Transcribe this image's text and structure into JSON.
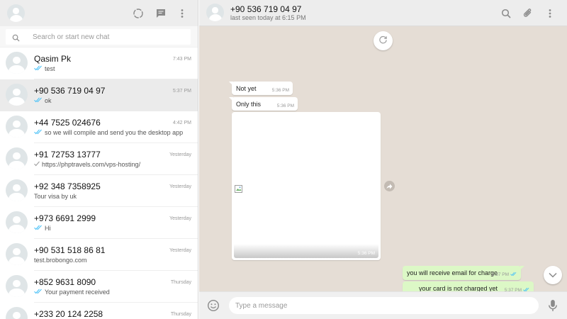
{
  "sidebar": {
    "search_placeholder": "Search or start new chat",
    "header_icons": [
      "status-icon",
      "new-chat-icon",
      "menu-icon"
    ],
    "chats": [
      {
        "name": "Qasim Pk",
        "time": "7:43 PM",
        "preview": "test",
        "tick": "double-blue"
      },
      {
        "name": "+90 536 719 04 97",
        "time": "5:37 PM",
        "preview": "ok",
        "tick": "double-blue",
        "active": true
      },
      {
        "name": "+44 7525 024676",
        "time": "4:42 PM",
        "preview": "so we will compile and send you the desktop app",
        "tick": "double-blue"
      },
      {
        "name": "+91 72753 13777",
        "time": "Yesterday",
        "preview": "https://phptravels.com/vps-hosting/",
        "tick": "single-grey"
      },
      {
        "name": "+92 348 7358925",
        "time": "Yesterday",
        "preview": "Tour visa by uk",
        "tick": "none"
      },
      {
        "name": "+973 6691 2999",
        "time": "Yesterday",
        "preview": "Hi",
        "tick": "double-blue"
      },
      {
        "name": "+90 531 518 86 81",
        "time": "Yesterday",
        "preview": "test.brobongo.com",
        "tick": "none"
      },
      {
        "name": "+852 9631 8090",
        "time": "Thursday",
        "preview": "Your payment received",
        "tick": "double-blue"
      },
      {
        "name": "+233 20 124 2258",
        "time": "Thursday",
        "preview": "",
        "tick": "none"
      }
    ]
  },
  "conversation": {
    "contact_name": "+90 536 719 04 97",
    "status": "last seen today at 6:15 PM",
    "messages": [
      {
        "text": "Not yet",
        "time": "5:36 PM",
        "direction": "in"
      },
      {
        "text": "Only this",
        "time": "5:36 PM",
        "direction": "in"
      },
      {
        "text": "",
        "time": "5:36 PM",
        "direction": "in",
        "type": "image"
      },
      {
        "text": "you will receive email for charge",
        "time": "5:37 PM",
        "direction": "out"
      },
      {
        "text": "your card is not charged yet",
        "time": "5:37 PM",
        "direction": "out"
      }
    ],
    "composer_placeholder": "Type a message"
  },
  "colors": {
    "header_bg": "#ededed",
    "chat_bg": "#e5ddd5",
    "outgoing_bubble": "#dcf8c6",
    "tick_blue": "#4fc3f7"
  }
}
